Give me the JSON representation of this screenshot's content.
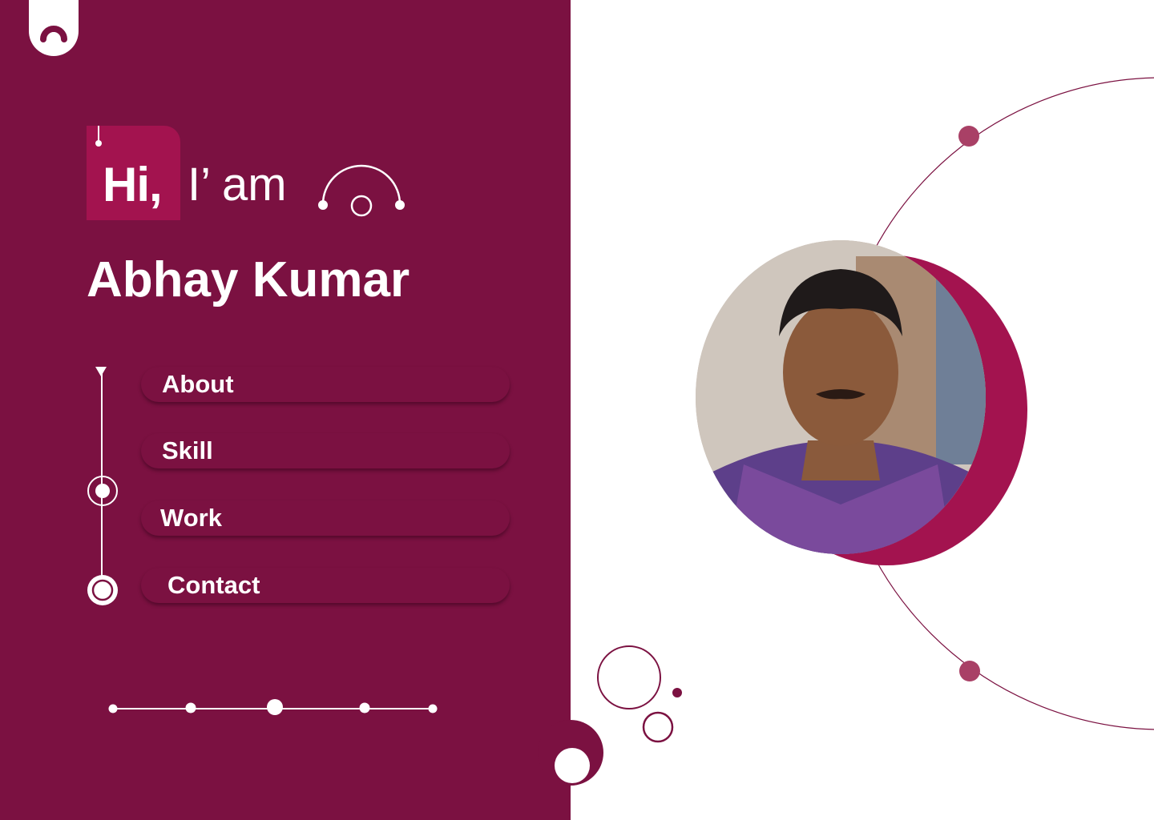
{
  "hero": {
    "greeting": "Hi,",
    "intro": "I’ am",
    "name": "Abhay Kumar"
  },
  "nav": {
    "items": [
      {
        "label": "About"
      },
      {
        "label": "Skill"
      },
      {
        "label": "Work"
      },
      {
        "label": "Contact"
      }
    ],
    "active_index": 2
  },
  "profile_photo": {
    "description": "portrait photo of person"
  },
  "colors": {
    "brand": "#7b1141",
    "accent": "#a3134f",
    "dot": "#a94066",
    "background": "#ffffff"
  },
  "icons": {
    "logo": "logo-icon",
    "decor_arc": "arc-decoration-icon"
  }
}
